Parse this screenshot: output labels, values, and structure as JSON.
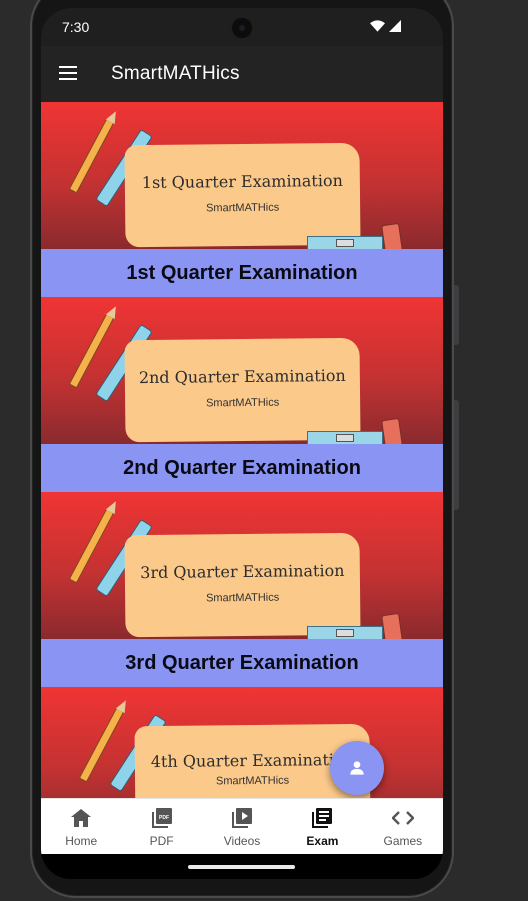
{
  "status_bar": {
    "time": "7:30"
  },
  "app_bar": {
    "title": "SmartMATHics"
  },
  "exams": [
    {
      "banner_title": "1st Quarter Examination",
      "banner_subtitle": "SmartMATHics",
      "label": "1st Quarter Examination"
    },
    {
      "banner_title": "2nd Quarter Examination",
      "banner_subtitle": "SmartMATHics",
      "label": "2nd Quarter Examination"
    },
    {
      "banner_title": "3rd Quarter Examination",
      "banner_subtitle": "SmartMATHics",
      "label": "3rd Quarter Examination"
    },
    {
      "banner_title": "4th Quarter Examination",
      "banner_subtitle": "SmartMATHics",
      "label": ""
    }
  ],
  "fab": {
    "icon": "person-icon"
  },
  "bottom_nav": {
    "items": [
      {
        "label": "Home",
        "icon": "home-icon"
      },
      {
        "label": "PDF",
        "icon": "pdf-icon"
      },
      {
        "label": "Videos",
        "icon": "video-library-icon"
      },
      {
        "label": "Exam",
        "icon": "exam-library-icon",
        "active": true
      },
      {
        "label": "Games",
        "icon": "code-icon"
      }
    ]
  },
  "colors": {
    "accent": "#8a94f3",
    "banner_red": "#f03434",
    "app_bar": "#232323"
  }
}
